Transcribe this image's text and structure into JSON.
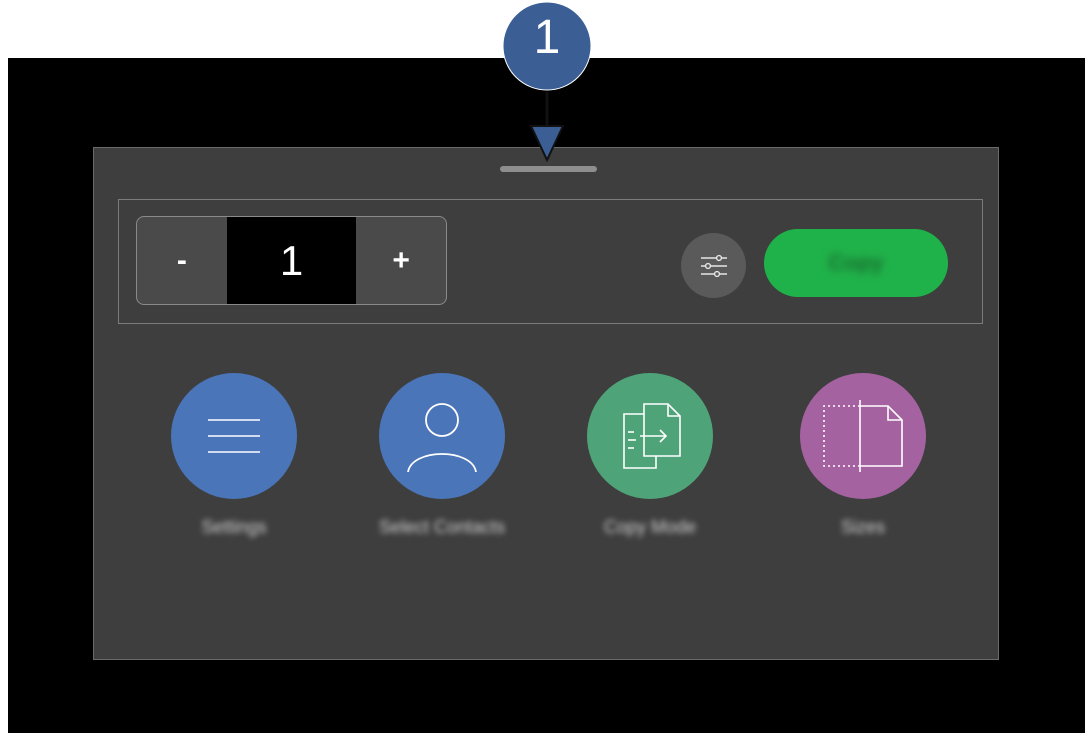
{
  "callout": {
    "number": "1",
    "color": "#3b5f94"
  },
  "stepper": {
    "minus_label": "-",
    "value": "1",
    "plus_label": "+"
  },
  "toolbar": {
    "settings_icon": "sliders-icon",
    "primary_label": "Copy",
    "primary_color": "#20b24a"
  },
  "tiles": [
    {
      "icon": "menu-lines-icon",
      "label": "Settings",
      "color": "#4a75b8"
    },
    {
      "icon": "person-icon",
      "label": "Select Contacts",
      "color": "#4a75b8"
    },
    {
      "icon": "copy-document-icon",
      "label": "Copy Mode",
      "color": "#4ea478"
    },
    {
      "icon": "page-size-icon",
      "label": "Sizes",
      "color": "#a562a0"
    }
  ]
}
